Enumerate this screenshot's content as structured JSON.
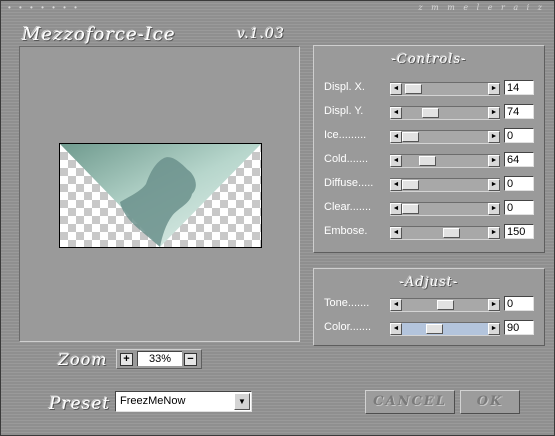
{
  "header": {
    "dots": "• • • • • • •",
    "author": "z m m e l e r a i z",
    "title": "Mezzoforce-Ice",
    "version": "v.1.03"
  },
  "controls": {
    "heading": "-Controls-",
    "sliders": [
      {
        "label": "Displ. X.",
        "value": "14",
        "fraction": 0.05
      },
      {
        "label": "Displ. Y.",
        "value": "74",
        "fraction": 0.29
      },
      {
        "label": "Ice.........",
        "value": "0",
        "fraction": 0.0
      },
      {
        "label": "Cold.......",
        "value": "64",
        "fraction": 0.25
      },
      {
        "label": "Diffuse.....",
        "value": "0",
        "fraction": 0.0
      },
      {
        "label": "Clear.......",
        "value": "0",
        "fraction": 0.0
      },
      {
        "label": "Embose.",
        "value": "150",
        "fraction": 0.59
      }
    ]
  },
  "adjust": {
    "heading": "-Adjust-",
    "sliders": [
      {
        "label": "Tone.......",
        "value": "0",
        "fraction": 0.5
      },
      {
        "label": "Color.......",
        "value": "90",
        "fraction": 0.35
      }
    ]
  },
  "zoom": {
    "label": "Zoom",
    "value": "33%",
    "plus": "+",
    "minus": "−"
  },
  "preset": {
    "label": "Preset",
    "selected": "FreezMeNow"
  },
  "buttons": {
    "cancel": "CANCEL",
    "ok": "OK"
  },
  "icons": {
    "arrow_left": "◄",
    "arrow_right": "►",
    "dropdown": "▼"
  },
  "colors": {
    "background": "#8f8f8f",
    "panel": "#9a9a9a",
    "ice": "#a9cbbd"
  }
}
